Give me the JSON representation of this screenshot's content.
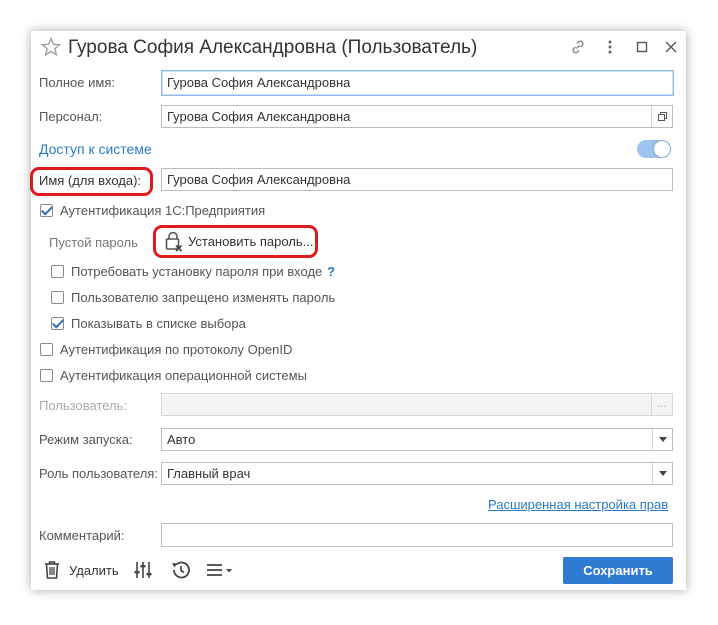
{
  "window": {
    "title": "Гурова София Александровна (Пользователь)",
    "icons": [
      "star-icon",
      "link-icon",
      "more-vertical-icon",
      "maximize-icon",
      "close-icon"
    ]
  },
  "form": {
    "full_name_label": "Полное имя:",
    "full_name_value": "Гурова София Александровна",
    "personnel_label": "Персонал:",
    "personnel_value": "Гурова София Александровна",
    "access_label": "Доступ к системе",
    "access_enabled": true,
    "login_label": "Имя (для входа):",
    "login_value": "Гурова София Александровна",
    "auth_1c_label": "Аутентификация 1С:Предприятия",
    "auth_1c_checked": true,
    "empty_password_label": "Пустой пароль",
    "set_password_label": "Установить пароль...",
    "require_password_label": "Потребовать установку пароля при входе",
    "require_password_help": "?",
    "require_password_checked": false,
    "forbid_change_label": "Пользователю запрещено изменять пароль",
    "forbid_change_checked": false,
    "show_in_list_label": "Показывать в списке выбора",
    "show_in_list_checked": true,
    "auth_openid_label": "Аутентификация по протоколу OpenID",
    "auth_openid_checked": false,
    "auth_os_label": "Аутентификация операционной системы",
    "auth_os_checked": false,
    "os_user_label": "Пользователь:",
    "os_user_value": "",
    "os_user_button": "...",
    "launch_mode_label": "Режим запуска:",
    "launch_mode_value": "Авто",
    "user_role_label": "Роль пользователя:",
    "user_role_value": "Главный врач",
    "advanced_rights_link": "Расширенная настройка прав",
    "comment_label": "Комментарий:",
    "comment_value": ""
  },
  "footer": {
    "delete_label": "Удалить",
    "save_label": "Сохранить"
  },
  "colors": {
    "accent": "#2e7bd1",
    "link": "#2a7ac4",
    "highlight": "#e0191b"
  }
}
